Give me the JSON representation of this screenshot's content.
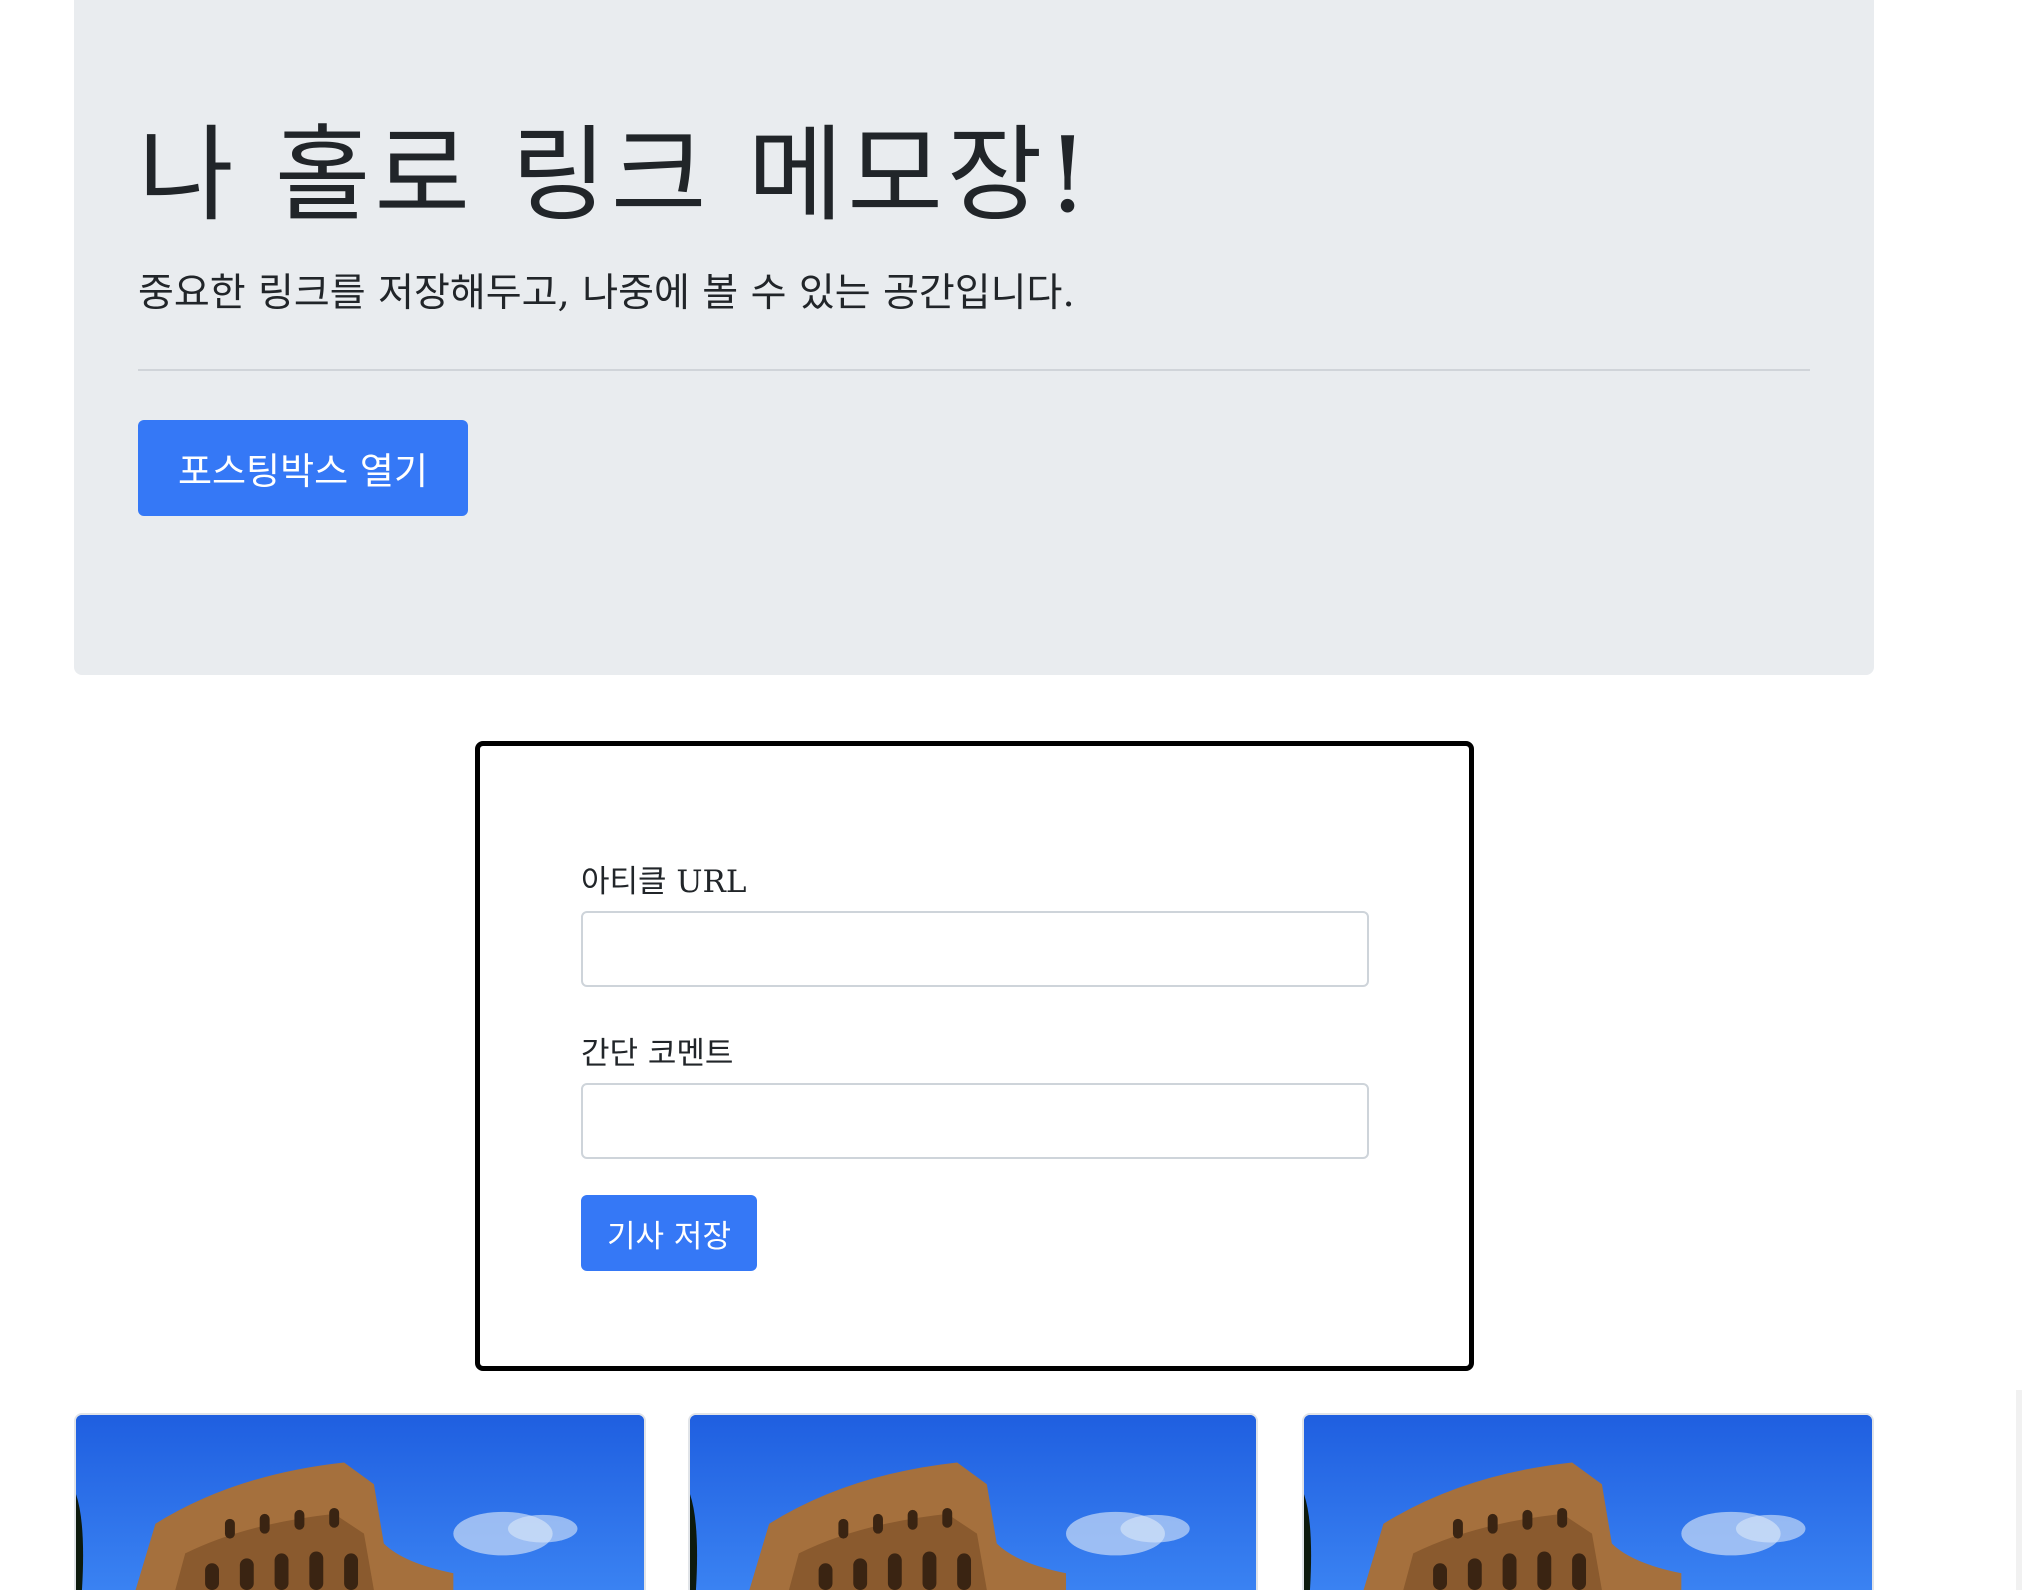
{
  "jumbotron": {
    "title": "나 홀로 링크 메모장!",
    "lead": "중요한 링크를 저장해두고, 나중에 볼 수 있는 공간입니다.",
    "open_button_label": "포스팅박스 열기"
  },
  "posting_box": {
    "url_label": "아티클 URL",
    "url_value": "",
    "comment_label": "간단 코멘트",
    "comment_value": "",
    "save_button_label": "기사 저장"
  },
  "cards": [
    {
      "image": "colosseum-photo"
    },
    {
      "image": "colosseum-photo"
    },
    {
      "image": "colosseum-photo"
    }
  ],
  "colors": {
    "primary": "#3578f6",
    "jumbotron_bg": "#e9ecef",
    "box_border": "#000000"
  }
}
